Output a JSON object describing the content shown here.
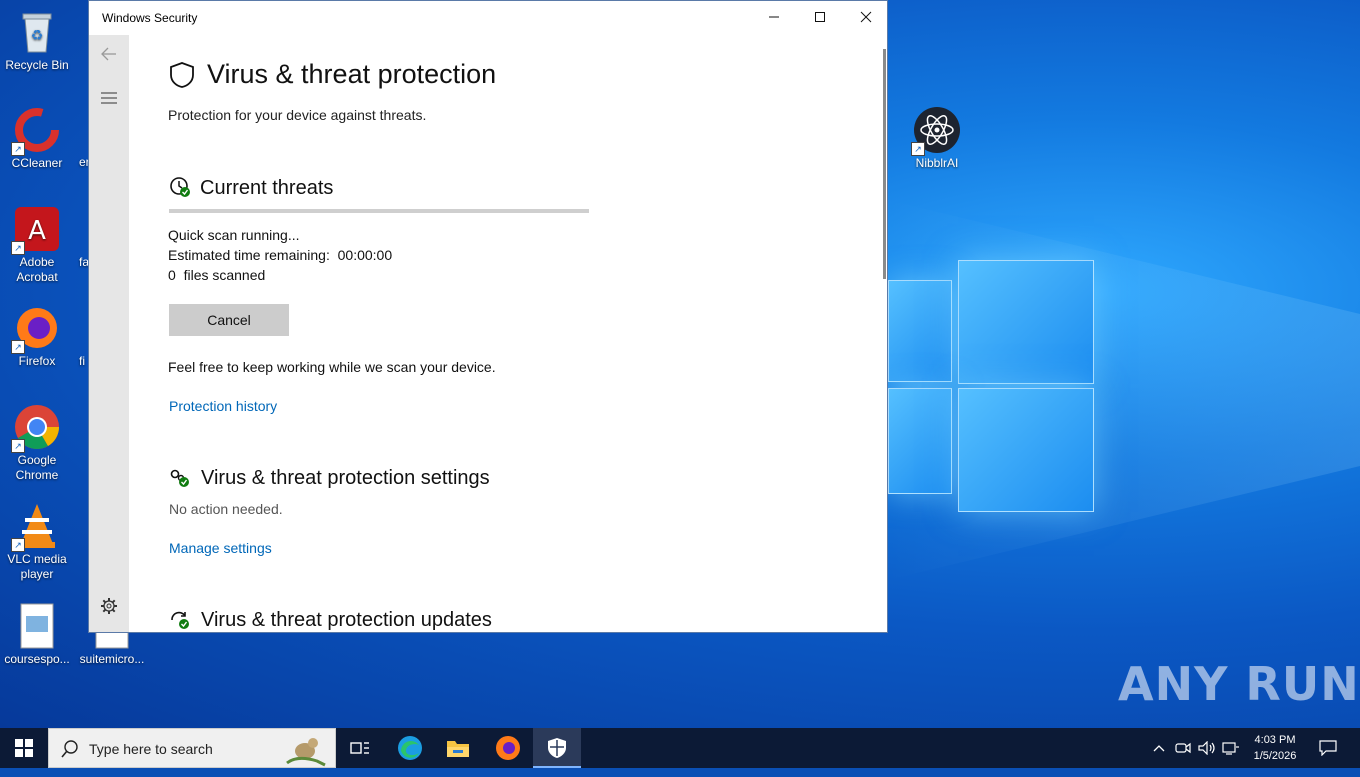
{
  "desktop": {
    "icons_left": [
      {
        "label": "Recycle Bin"
      },
      {
        "label": "CCleaner"
      },
      {
        "label": "Adobe Acrobat"
      },
      {
        "label": "Firefox"
      },
      {
        "label": "Google Chrome"
      },
      {
        "label": "VLC media player"
      },
      {
        "label": "coursespo..."
      }
    ],
    "icons_col2": [
      {
        "label": "er"
      },
      {
        "label": "fa"
      },
      {
        "label": "fi"
      },
      {
        "label": "suitemicro..."
      }
    ],
    "icon_right": {
      "label": "NibblrAI"
    },
    "watermark": "ANY RUN"
  },
  "window": {
    "title": "Windows Security",
    "page_title": "Virus & threat protection",
    "subtitle": "Protection for your device against threats.",
    "current_threats": {
      "heading": "Current threats",
      "status": "Quick scan running...",
      "time_label": "Estimated time remaining:",
      "time_value": "00:00:00",
      "files_count": "0",
      "files_label": "files scanned",
      "progress": 0.0,
      "cancel_label": "Cancel",
      "note": "Feel free to keep working while we scan your device.",
      "history_link": "Protection history"
    },
    "settings": {
      "heading": "Virus & threat protection settings",
      "status": "No action needed.",
      "link": "Manage settings"
    },
    "updates": {
      "heading": "Virus & threat protection updates"
    }
  },
  "taskbar": {
    "search_placeholder": "Type here to search",
    "time": "4:03 PM",
    "date": "1/5/2026"
  },
  "colors": {
    "accent": "#0067b8",
    "taskbar": "#0c1a36"
  }
}
